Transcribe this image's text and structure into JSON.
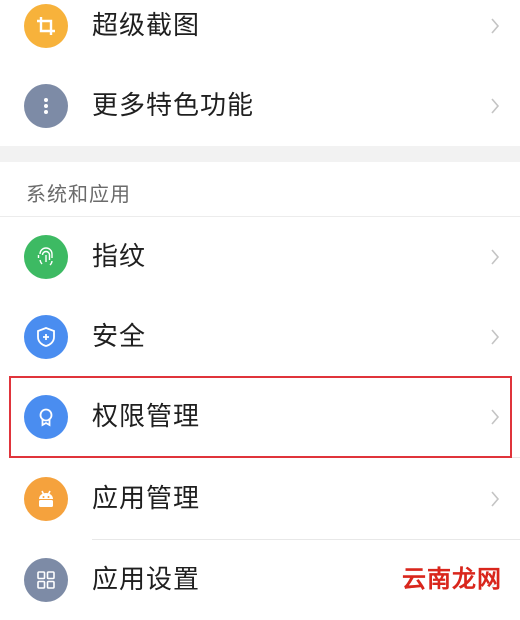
{
  "settings": {
    "items_top": [
      {
        "label": "超级截图",
        "icon": "crop-icon",
        "color": "#F7B23B"
      },
      {
        "label": "更多特色功能",
        "icon": "more-vertical-icon",
        "color": "#7D8BA6"
      }
    ],
    "section_header": "系统和应用",
    "items_section": [
      {
        "label": "指纹",
        "icon": "fingerprint-icon",
        "color": "#3DBA63"
      },
      {
        "label": "安全",
        "icon": "shield-icon",
        "color": "#4A8DF0"
      },
      {
        "label": "权限管理",
        "icon": "badge-icon",
        "color": "#4A8DF0"
      },
      {
        "label": "应用管理",
        "icon": "android-robot-icon",
        "color": "#F5A23D"
      },
      {
        "label": "应用设置",
        "icon": "grid-icon",
        "color": "#7D8BA6"
      }
    ]
  },
  "watermark": "云南龙网",
  "highlight_color": "#E0343B"
}
